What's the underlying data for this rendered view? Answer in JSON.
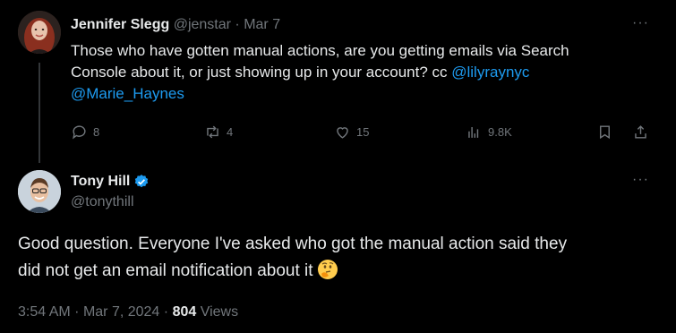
{
  "first_post": {
    "author_name": "Jennifer Slegg",
    "handle": "@jenstar",
    "separator": "·",
    "date": "Mar 7",
    "text_lines": [
      "Those who have gotten manual actions, are you getting emails via Search",
      "Console about it, or just showing up in your account?  cc "
    ],
    "mention_1": "@lilyraynyc",
    "mention_2": "@Marie_Haynes",
    "replies": "8",
    "reposts": "4",
    "likes": "15",
    "views": "9.8K"
  },
  "second_post": {
    "author_name": "Tony Hill",
    "handle": "@tonythill",
    "text_line_1": "Good question. Everyone I've asked who got the manual action said they",
    "text_line_2": "did not get an email notification about it ",
    "emoji": "thinking-face",
    "time": "3:54 AM",
    "date": "Mar 7, 2024",
    "dot": "·",
    "views_count": "804",
    "views_label": "Views"
  },
  "colors": {
    "background": "#000000",
    "text": "#e7e9ea",
    "muted": "#71767b",
    "link": "#1d9bf0",
    "verified": "#1d9bf0"
  }
}
